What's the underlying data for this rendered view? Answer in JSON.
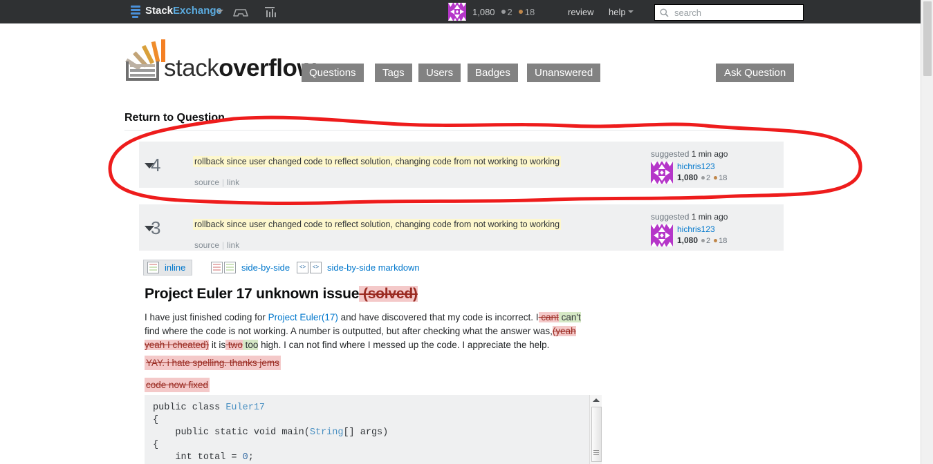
{
  "topbar": {
    "site_name_prefix": "Stack",
    "site_name_suffix": "Exchange",
    "inbox_icon": "inbox-icon",
    "achievements_icon": "achievements-icon",
    "user": {
      "reputation": "1,080",
      "silver_badges": "2",
      "bronze_badges": "18",
      "avatar": "identicon-avatar"
    },
    "review_label": "review",
    "help_label": "help",
    "search_placeholder": "search",
    "search_value": "",
    "search_icon": "search-icon",
    "bg_color": "#2f3133",
    "link_color": "#5babdf"
  },
  "header": {
    "logo_text_prefix": "stack",
    "logo_text_suffix": "overflow",
    "logo_icon": "stackoverflow-logo",
    "nav": [
      {
        "label": "Questions",
        "name": "nav-questions"
      },
      {
        "label": "Tags",
        "name": "nav-tags"
      },
      {
        "label": "Users",
        "name": "nav-users"
      },
      {
        "label": "Badges",
        "name": "nav-badges"
      },
      {
        "label": "Unanswered",
        "name": "nav-unanswered"
      }
    ],
    "ask_question_label": "Ask Question",
    "nav_bg_color": "#828282"
  },
  "page": {
    "return_link_label": "Return to Question"
  },
  "revisions": [
    {
      "number": "4",
      "comment": "rollback since user changed code to reflect solution, changing code from not working to working",
      "source_label": "source",
      "link_label": "link",
      "status": "suggested",
      "time": "1 min ago",
      "user_name": "hichris123",
      "user_rep": "1,080",
      "silver_badges": "2",
      "bronze_badges": "18"
    },
    {
      "number": "3",
      "comment": "rollback since user changed code to reflect solution, changing code from not working to working",
      "source_label": "source",
      "link_label": "link",
      "status": "suggested",
      "time": "1 min ago",
      "user_name": "hichris123",
      "user_rep": "1,080",
      "silver_badges": "2",
      "bronze_badges": "18"
    }
  ],
  "view_tabs": [
    {
      "label": "inline",
      "name": "tab-inline",
      "selected": true
    },
    {
      "label": "side-by-side",
      "name": "tab-side-by-side",
      "selected": false
    },
    {
      "label": "side-by-side markdown",
      "name": "tab-side-by-side-markdown",
      "selected": false
    }
  ],
  "post": {
    "title_kept": "Project Euler 17 unknown issue",
    "title_deleted": " (solved)",
    "body": {
      "s1": "I have just finished coding for ",
      "link": "Project Euler(17)",
      "s2": " and have discovered that my code is incorrect. I",
      "del1": " cant",
      "ins1": " can't",
      "s3": " find where the code is not working. A number is outputted, but after checking what the answer was,",
      "del2": "(yeah yeah I cheated)",
      "s4": " it is",
      "del3": " two",
      "ins2": " too",
      "s5": " high. I can not find where I messed up the code. I appreciate the help."
    },
    "deleted_paragraphs": [
      "YAY. i hate spelling. thanks jems",
      "code now fixed"
    ],
    "code": {
      "line1_kw": "public class ",
      "line1_type": "Euler17",
      "line2": "{",
      "line3_kw": "    public static void main(",
      "line3_type": "String",
      "line3_rest": "[] args)",
      "line4": "{",
      "line5_kw": "    int total = ",
      "line5_num": "0",
      "line5_end": ";"
    }
  },
  "annotation": {
    "color": "#ee1c1c",
    "shape": "hand-drawn-ellipse-around-revision-4"
  },
  "diff_colors": {
    "deleted_bg": "#f4c9c9",
    "deleted_fg": "#9a2b22",
    "inserted_bg": "#d6e9c6",
    "comment_highlight": "#fdf7cd"
  }
}
